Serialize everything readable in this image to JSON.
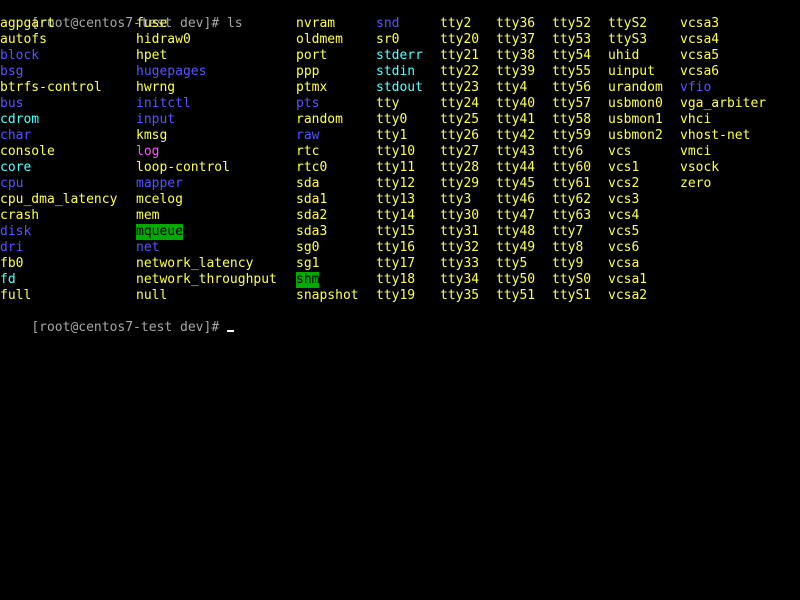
{
  "colors": {
    "background": "#000000",
    "prompt": "#a8a8a8",
    "device": "#ffff55",
    "directory": "#5555ff",
    "symlink": "#55ffff",
    "sticky_dir_fg": "#000000",
    "sticky_dir_bg": "#00aa00",
    "cursor": "#ffffff"
  },
  "prompt": {
    "first": "[root@centos7-test dev]# ",
    "first_command": "ls",
    "second": "[root@centos7-test dev]# ",
    "cursor_icon": "block-underscore-cursor"
  },
  "listing": {
    "columns": [
      [
        "agpgart",
        "autofs",
        "block",
        "bsg",
        "btrfs-control",
        "bus",
        "cdrom",
        "char",
        "console",
        "core",
        "cpu",
        "cpu_dma_latency",
        "crash",
        "disk",
        "dri",
        "fb0",
        "fd",
        "full"
      ],
      [
        "fuse",
        "hidraw0",
        "hpet",
        "hugepages",
        "hwrng",
        "initctl",
        "input",
        "kmsg",
        "log",
        "loop-control",
        "mapper",
        "mcelog",
        "mem",
        "mqueue",
        "net",
        "network_latency",
        "network_throughput",
        "null"
      ],
      [
        "nvram",
        "oldmem",
        "port",
        "ppp",
        "ptmx",
        "pts",
        "random",
        "raw",
        "rtc",
        "rtc0",
        "sda",
        "sda1",
        "sda2",
        "sda3",
        "sg0",
        "sg1",
        "shm",
        "snapshot"
      ],
      [
        "snd",
        "sr0",
        "stderr",
        "stdin",
        "stdout",
        "tty",
        "tty0",
        "tty1",
        "tty10",
        "tty11",
        "tty12",
        "tty13",
        "tty14",
        "tty15",
        "tty16",
        "tty17",
        "tty18",
        "tty19"
      ],
      [
        "tty2",
        "tty20",
        "tty21",
        "tty22",
        "tty23",
        "tty24",
        "tty25",
        "tty26",
        "tty27",
        "tty28",
        "tty29",
        "tty3",
        "tty30",
        "tty31",
        "tty32",
        "tty33",
        "tty34",
        "tty35"
      ],
      [
        "tty36",
        "tty37",
        "tty38",
        "tty39",
        "tty4",
        "tty40",
        "tty41",
        "tty42",
        "tty43",
        "tty44",
        "tty45",
        "tty46",
        "tty47",
        "tty48",
        "tty49",
        "tty5",
        "tty50",
        "tty51"
      ],
      [
        "tty52",
        "tty53",
        "tty54",
        "tty55",
        "tty56",
        "tty57",
        "tty58",
        "tty59",
        "tty6",
        "tty60",
        "tty61",
        "tty62",
        "tty63",
        "tty7",
        "tty8",
        "tty9",
        "ttyS0",
        "ttyS1"
      ],
      [
        "ttyS2",
        "ttyS3",
        "uhid",
        "uinput",
        "urandom",
        "usbmon0",
        "usbmon1",
        "usbmon2",
        "vcs",
        "vcs1",
        "vcs2",
        "vcs3",
        "vcs4",
        "vcs5",
        "vcs6",
        "vcsa",
        "vcsa1",
        "vcsa2"
      ],
      [
        "vcsa3",
        "vcsa4",
        "vcsa5",
        "vcsa6",
        "vfio",
        "vga_arbiter",
        "vhci",
        "vhost-net",
        "vmci",
        "vsock",
        "zero"
      ]
    ],
    "entry_types": {
      "block": "directory",
      "bsg": "directory",
      "bus": "directory",
      "char": "directory",
      "cpu": "directory",
      "disk": "directory",
      "dri": "directory",
      "hugepages": "directory",
      "initctl": "directory",
      "input": "directory",
      "mapper": "directory",
      "net": "directory",
      "pts": "directory",
      "raw": "directory",
      "snd": "directory",
      "vfio": "directory",
      "cdrom": "symlink",
      "core": "symlink",
      "fd": "symlink",
      "log": "socket",
      "stderr": "symlink",
      "stdin": "symlink",
      "stdout": "symlink",
      "mqueue": "sticky_dir",
      "shm": "sticky_dir"
    },
    "default_type": "device"
  }
}
